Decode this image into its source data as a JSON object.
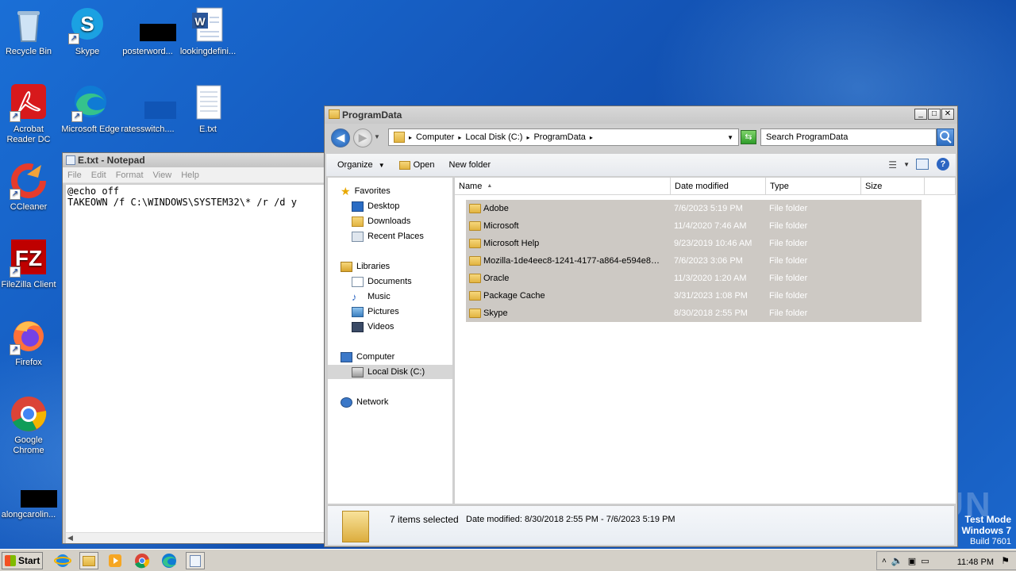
{
  "desktop": {
    "icons": [
      {
        "label": "Recycle Bin"
      },
      {
        "label": "Skype"
      },
      {
        "label": "posterword..."
      },
      {
        "label": "lookingdefini..."
      },
      {
        "label": "Acrobat Reader DC"
      },
      {
        "label": "Microsoft Edge"
      },
      {
        "label": "ratesswitch...."
      },
      {
        "label": "E.txt"
      },
      {
        "label": "CCleaner"
      },
      {
        "label": "FileZilla Client"
      },
      {
        "label": "Firefox"
      },
      {
        "label": "Google Chrome"
      },
      {
        "label": "alongcarolin..."
      }
    ],
    "watermark": {
      "line1": "Test Mode",
      "line2": "Windows 7",
      "line3": "Build 7601",
      "brand": "ANY RUN"
    }
  },
  "notepad": {
    "title": "E.txt - Notepad",
    "menu": [
      "File",
      "Edit",
      "Format",
      "View",
      "Help"
    ],
    "lines": [
      "@echo off",
      "TAKEOWN /f C:\\WINDOWS\\SYSTEM32\\* /r /d y"
    ]
  },
  "explorer": {
    "title": "ProgramData",
    "breadcrumb": [
      "Computer",
      "Local Disk (C:)",
      "ProgramData"
    ],
    "search_placeholder": "Search ProgramData",
    "toolbar": {
      "organize": "Organize",
      "open": "Open",
      "new_folder": "New folder"
    },
    "nav": {
      "favorites": "Favorites",
      "favorites_items": [
        "Desktop",
        "Downloads",
        "Recent Places"
      ],
      "libraries": "Libraries",
      "libraries_items": [
        "Documents",
        "Music",
        "Pictures",
        "Videos"
      ],
      "computer": "Computer",
      "computer_items": [
        "Local Disk (C:)"
      ],
      "network": "Network"
    },
    "columns": [
      "Name",
      "Date modified",
      "Type",
      "Size"
    ],
    "files": [
      {
        "name": "Adobe",
        "date": "7/6/2023 5:19 PM",
        "type": "File folder"
      },
      {
        "name": "Microsoft",
        "date": "11/4/2020 7:46 AM",
        "type": "File folder"
      },
      {
        "name": "Microsoft Help",
        "date": "9/23/2019 10:46 AM",
        "type": "File folder"
      },
      {
        "name": "Mozilla-1de4eec8-1241-4177-a864-e594e8d...",
        "date": "7/6/2023 3:06 PM",
        "type": "File folder"
      },
      {
        "name": "Oracle",
        "date": "11/3/2020 1:20 AM",
        "type": "File folder"
      },
      {
        "name": "Package Cache",
        "date": "3/31/2023 1:08 PM",
        "type": "File folder"
      },
      {
        "name": "Skype",
        "date": "8/30/2018 2:55 PM",
        "type": "File folder"
      }
    ],
    "details": {
      "count": "7 items selected",
      "date_label": "Date modified:",
      "date_range": "8/30/2018 2:55 PM - 7/6/2023 5:19 PM"
    }
  },
  "taskbar": {
    "start": "Start",
    "clock": "11:48 PM"
  }
}
